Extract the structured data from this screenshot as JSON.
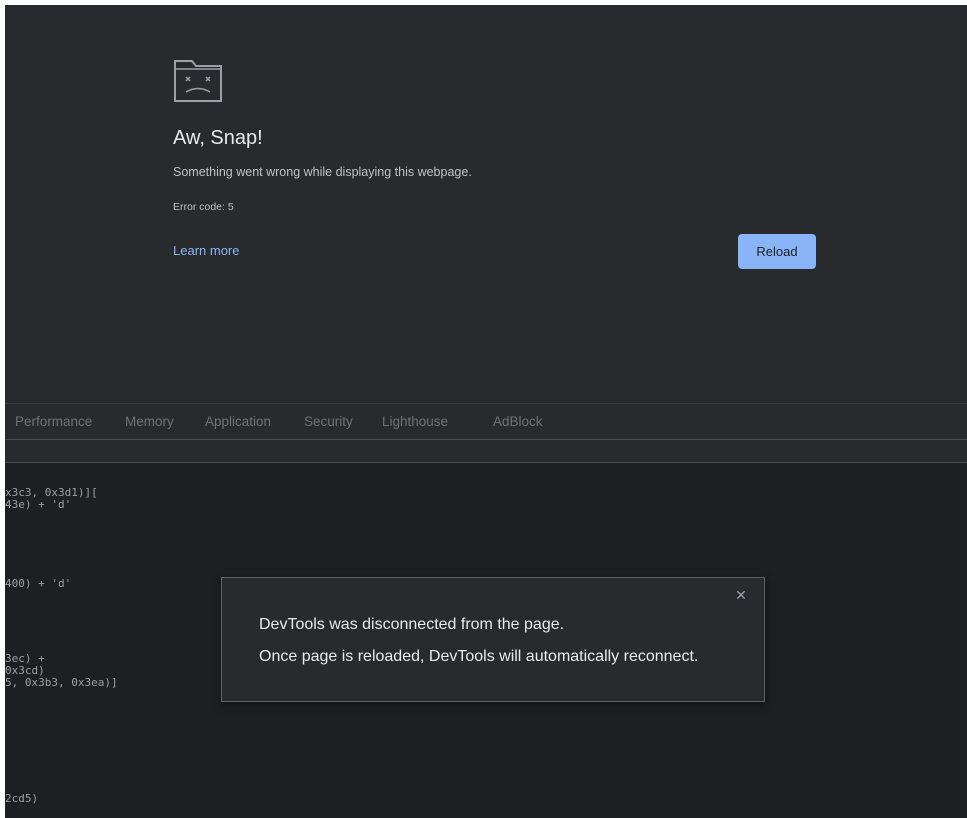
{
  "crash_page": {
    "icon": "sad-folder-icon",
    "title": "Aw, Snap!",
    "message": "Something went wrong while displaying this webpage.",
    "error_code": "Error code: 5",
    "learn_more": "Learn more",
    "reload_label": "Reload"
  },
  "devtools": {
    "tabs": [
      "Performance",
      "Memory",
      "Application",
      "Security",
      "Lighthouse",
      "AdBlock"
    ],
    "code_lines": [
      "x3c3, 0x3d1)][",
      "43e) + 'd'",
      "400) + 'd'",
      "3ec) +",
      "0x3cd)",
      "5, 0x3b3, 0x3ea)]",
      "2cd5)"
    ],
    "dialog": {
      "close_icon": "close-icon",
      "line1": "DevTools was disconnected from the page.",
      "line2": "Once page is reloaded, DevTools will automatically reconnect."
    }
  },
  "colors": {
    "background": "#202124",
    "crash_background": "#292a2d",
    "accent": "#8ab4f8",
    "text_primary": "#e8eaed",
    "text_secondary": "#bdc1c6"
  }
}
